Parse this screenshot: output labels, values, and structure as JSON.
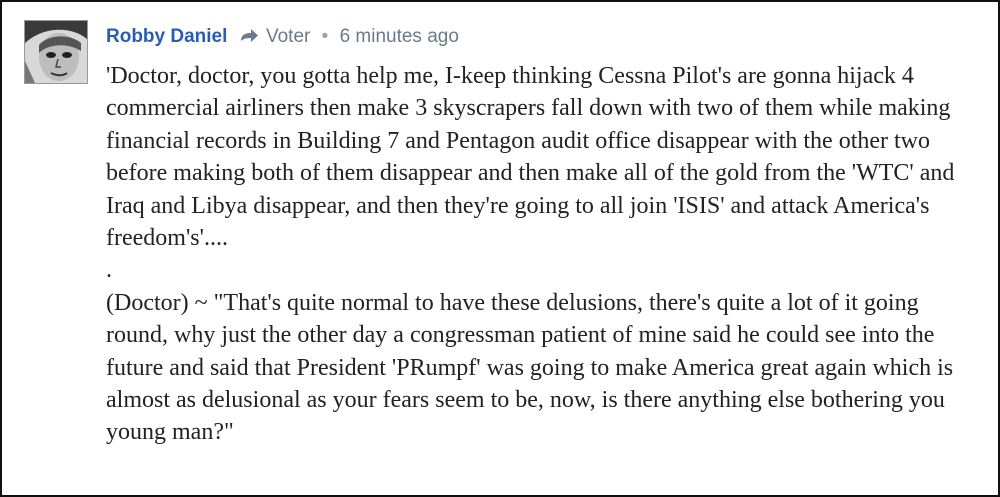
{
  "comment": {
    "author": "Robby Daniel",
    "reply_to": "Voter",
    "separator": "•",
    "timestamp": "6 minutes ago",
    "avatar_icon": "avatar-face-icon",
    "reply_icon": "reply-arrow-icon",
    "paragraphs": [
      "'Doctor, doctor, you gotta help me, I-keep thinking Cessna Pilot's are gonna hijack 4 commercial airliners then make 3 skyscrapers fall down with two of them while making financial records in Building 7 and Pentagon audit office disappear with the other two before making both of them disappear and then make all of the gold from the 'WTC' and Iraq and Libya disappear, and then they're going to all join 'ISIS' and attack America's freedom's'....",
      ".",
      "(Doctor) ~ \"That's quite normal to have these delusions, there's quite a lot of it going round, why just the other day a congressman patient of mine said he could see into the future and said that President 'PRumpf' was going to make America great again which is almost as delusional as your fears seem to be, now, is there anything else bothering you young man?\""
    ]
  },
  "colors": {
    "author": "#2a5db0",
    "meta": "#6b7a8a",
    "text": "#222222",
    "border": "#111111"
  }
}
